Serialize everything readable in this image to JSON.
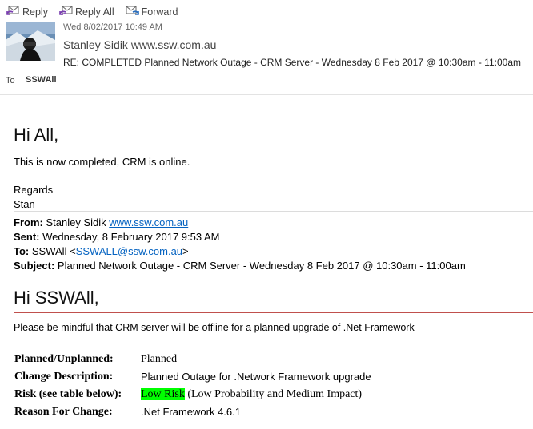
{
  "toolbar": {
    "reply": "Reply",
    "reply_all": "Reply All",
    "forward": "Forward"
  },
  "header": {
    "date": "Wed 8/02/2017 10:49 AM",
    "sender": "Stanley Sidik www.ssw.com.au",
    "subject": "RE: COMPLETED Planned Network Outage - CRM Server - Wednesday 8 Feb 2017 @ 10:30am - 11:00am",
    "to_label": "To",
    "to": "SSWAll"
  },
  "reply_body": {
    "greeting": "Hi All,",
    "message": "This is now completed, CRM is online.",
    "regards": "Regards",
    "signature": "Stan"
  },
  "forwarded": {
    "from_label": "From:",
    "from_name": "Stanley Sidik",
    "from_link": "www.ssw.com.au",
    "sent_label": "Sent:",
    "sent": "Wednesday, 8 February 2017 9:53 AM",
    "to_label": "To:",
    "to_name": "SSWAll <",
    "to_email": "SSWALL@ssw.com.au",
    "to_close": ">",
    "subject_label": "Subject:",
    "subject": "Planned Network Outage - CRM Server - Wednesday 8 Feb 2017 @ 10:30am - 11:00am"
  },
  "original_body": {
    "greeting": "Hi SSWAll,",
    "message": "Please be mindful that CRM server will be offline for a planned upgrade of .Net Framework",
    "details": [
      {
        "label": "Planned/Unplanned:",
        "value": "Planned"
      },
      {
        "label": "Change Description:",
        "value": "Planned Outage for .Network Framework upgrade"
      },
      {
        "label": "Risk (see table below):",
        "value_highlight": "Low Risk",
        "value_rest": " (Low Probability and Medium Impact)"
      },
      {
        "label": "Reason For Change:",
        "value": ".Net Framework 4.6.1"
      }
    ]
  },
  "colors": {
    "link": "#0563c1",
    "highlight": "#00ff00",
    "divider_red": "#c0504d",
    "icon_purple": "#7a3fb0"
  },
  "icons": [
    "reply-icon",
    "reply-all-icon",
    "forward-icon"
  ]
}
